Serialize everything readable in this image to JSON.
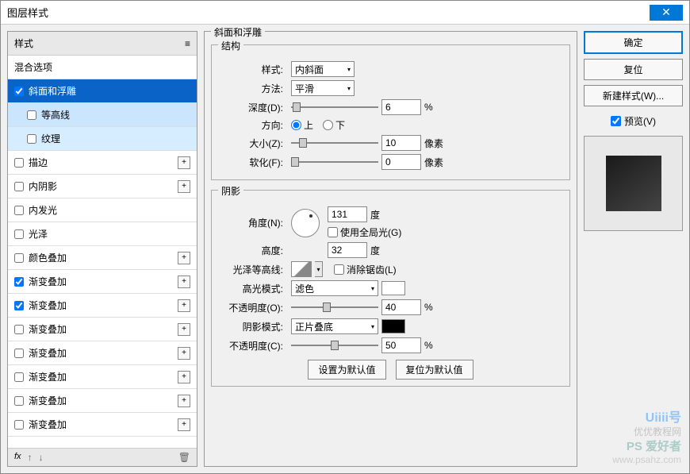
{
  "title": "图层样式",
  "left": {
    "header": "样式",
    "blend": "混合选项",
    "items": [
      {
        "label": "斜面和浮雕",
        "checked": true,
        "selected": true
      },
      {
        "label": "等高线",
        "checked": false,
        "sub": true
      },
      {
        "label": "纹理",
        "checked": false,
        "sub": true
      },
      {
        "label": "描边",
        "checked": false,
        "add": true
      },
      {
        "label": "内阴影",
        "checked": false,
        "add": true
      },
      {
        "label": "内发光",
        "checked": false
      },
      {
        "label": "光泽",
        "checked": false
      },
      {
        "label": "颜色叠加",
        "checked": false,
        "add": true
      },
      {
        "label": "渐变叠加",
        "checked": true,
        "add": true
      },
      {
        "label": "渐变叠加",
        "checked": true,
        "add": true
      },
      {
        "label": "渐变叠加",
        "checked": false,
        "add": true
      },
      {
        "label": "渐变叠加",
        "checked": false,
        "add": true
      },
      {
        "label": "渐变叠加",
        "checked": false,
        "add": true
      },
      {
        "label": "渐变叠加",
        "checked": false,
        "add": true
      },
      {
        "label": "渐变叠加",
        "checked": false,
        "add": true
      }
    ],
    "fx": "fx"
  },
  "center": {
    "main_title": "斜面和浮雕",
    "structure": {
      "title": "结构",
      "style_label": "样式:",
      "style_value": "内斜面",
      "method_label": "方法:",
      "method_value": "平滑",
      "depth_label": "深度(D):",
      "depth_value": "6",
      "depth_unit": "%",
      "direction_label": "方向:",
      "up": "上",
      "down": "下",
      "size_label": "大小(Z):",
      "size_value": "10",
      "size_unit": "像素",
      "soften_label": "软化(F):",
      "soften_value": "0",
      "soften_unit": "像素"
    },
    "shadow": {
      "title": "阴影",
      "angle_label": "角度(N):",
      "angle_value": "131",
      "angle_unit": "度",
      "global_light": "使用全局光(G)",
      "altitude_label": "高度:",
      "altitude_value": "32",
      "altitude_unit": "度",
      "gloss_label": "光泽等高线:",
      "antialias": "消除锯齿(L)",
      "highlight_mode_label": "高光模式:",
      "highlight_mode_value": "滤色",
      "highlight_opacity_label": "不透明度(O):",
      "highlight_opacity_value": "40",
      "highlight_opacity_unit": "%",
      "shadow_mode_label": "阴影模式:",
      "shadow_mode_value": "正片叠底",
      "shadow_opacity_label": "不透明度(C):",
      "shadow_opacity_value": "50",
      "shadow_opacity_unit": "%"
    },
    "set_default": "设置为默认值",
    "reset_default": "复位为默认值"
  },
  "right": {
    "ok": "确定",
    "cancel": "复位",
    "new_style": "新建样式(W)...",
    "preview": "预览(V)"
  },
  "watermark": {
    "l1": "Uiiii号",
    "l2": "优优教程网",
    "l3": "PS 爱好者",
    "l4": "www.psahz.com"
  }
}
